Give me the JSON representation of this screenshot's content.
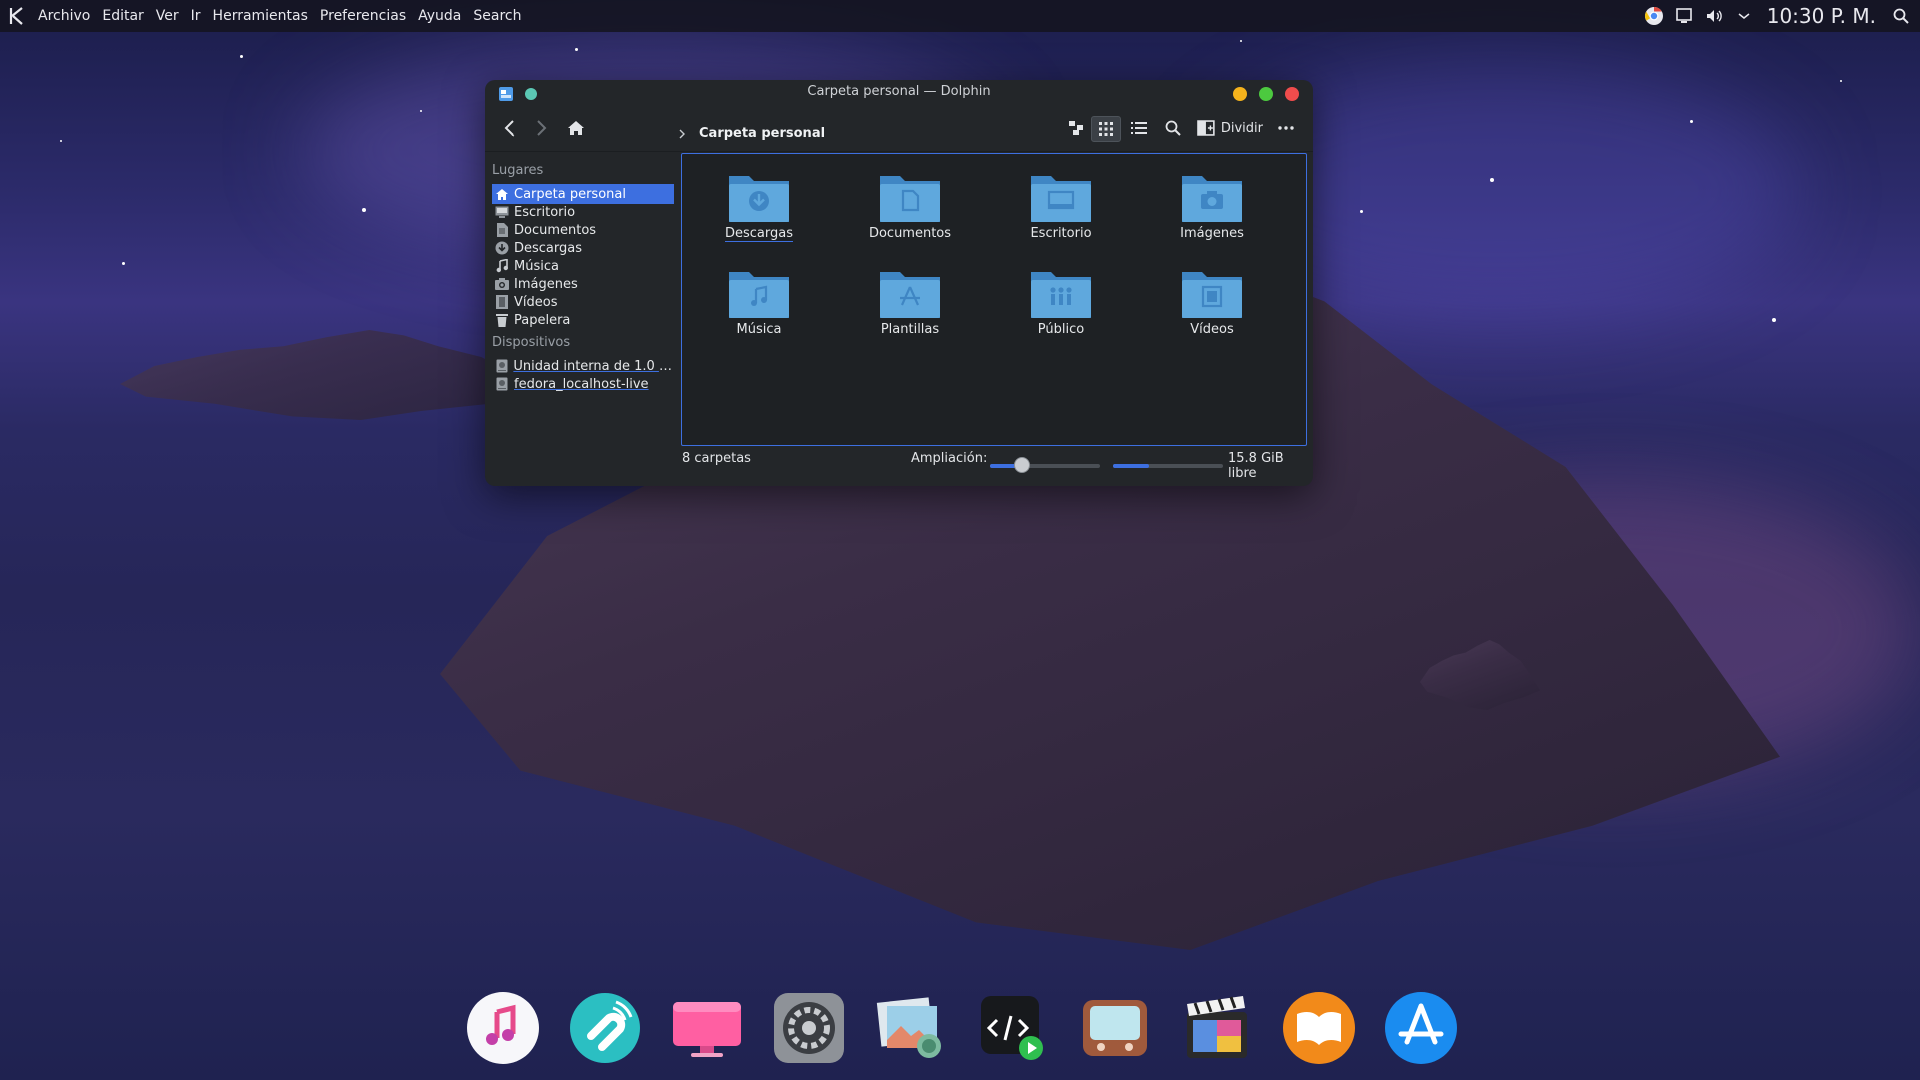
{
  "menubar": {
    "app_logo": "kde-k-icon",
    "menus": [
      "Archivo",
      "Editar",
      "Ver",
      "Ir",
      "Herramientas",
      "Preferencias",
      "Ayuda",
      "Search"
    ],
    "clock": "10:30 P. M.",
    "tray_icons": [
      "chrome-icon",
      "clipboard-monitor-icon",
      "volume-icon",
      "chevron-down-icon",
      "search-icon"
    ]
  },
  "window": {
    "title": "Carpeta personal — Dolphin",
    "breadcrumb": "Carpeta personal",
    "split_label": "Dividir",
    "sidebar": {
      "places_header": "Lugares",
      "places": [
        {
          "label": "Carpeta personal",
          "icon": "home-icon",
          "selected": true
        },
        {
          "label": "Escritorio",
          "icon": "desktop-icon"
        },
        {
          "label": "Documentos",
          "icon": "documents-icon"
        },
        {
          "label": "Descargas",
          "icon": "downloads-icon"
        },
        {
          "label": "Música",
          "icon": "music-icon"
        },
        {
          "label": "Imágenes",
          "icon": "pictures-icon"
        },
        {
          "label": "Vídeos",
          "icon": "videos-icon"
        },
        {
          "label": "Papelera",
          "icon": "trash-icon"
        }
      ],
      "devices_header": "Dispositivos",
      "devices": [
        {
          "label": "Unidad interna de 1.0 G...",
          "icon": "drive-icon"
        },
        {
          "label": "fedora_localhost-live",
          "icon": "drive-icon"
        }
      ]
    },
    "folders": [
      {
        "label": "Descargas",
        "icon": "download-folder-icon"
      },
      {
        "label": "Documentos",
        "icon": "documents-folder-icon"
      },
      {
        "label": "Escritorio",
        "icon": "desktop-folder-icon"
      },
      {
        "label": "Imágenes",
        "icon": "pictures-folder-icon"
      },
      {
        "label": "Música",
        "icon": "music-folder-icon"
      },
      {
        "label": "Plantillas",
        "icon": "templates-folder-icon"
      },
      {
        "label": "Público",
        "icon": "public-folder-icon"
      },
      {
        "label": "Vídeos",
        "icon": "videos-folder-icon"
      }
    ],
    "status": {
      "count": "8 carpetas",
      "zoom_label": "Ampliación:",
      "zoom_fraction": 0.28,
      "free_space": "15.8 GiB libre",
      "space_used_fraction": 0.33
    }
  },
  "dock": {
    "apps": [
      "music-app-icon",
      "magnet-app-icon",
      "imac-app-icon",
      "system-preferences-icon",
      "preview-app-icon",
      "code-editor-icon",
      "tv-app-icon",
      "final-cut-icon",
      "books-app-icon",
      "app-store-icon"
    ]
  },
  "colors": {
    "accent": "#3d6fe0",
    "window_bg": "#232629",
    "folder_blue": "#5fa8dd",
    "close": "#ef4c4c",
    "minimize": "#f5b31c",
    "maximize": "#4cc93f"
  }
}
